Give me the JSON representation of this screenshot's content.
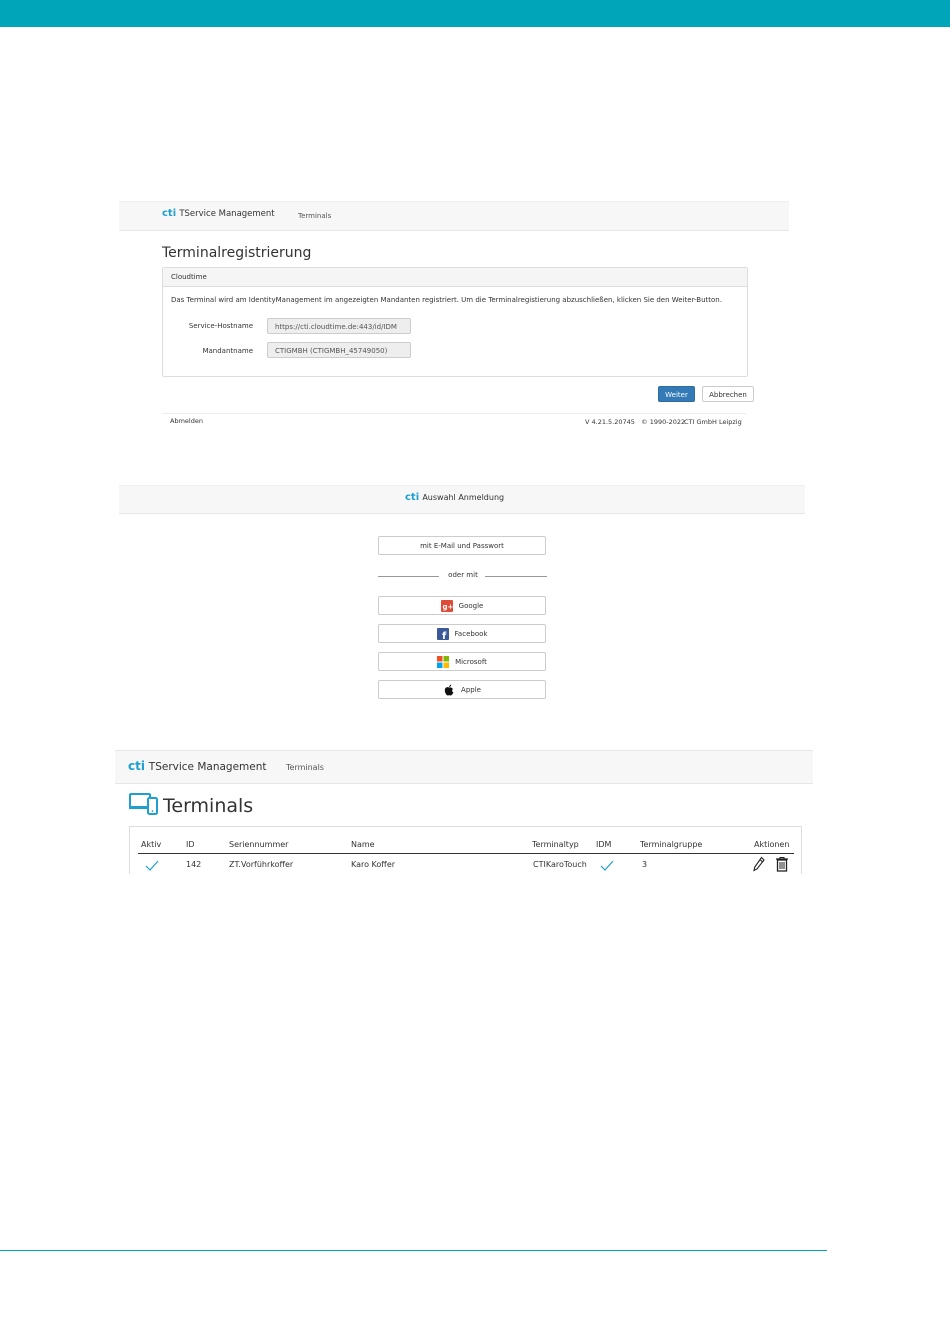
{
  "colors": {
    "accent": "#00a5b9",
    "brand": "#1e9fd0",
    "primary_button": "#337ab7"
  },
  "registration": {
    "brand_logo": "cti",
    "brand_name": "TService Management",
    "nav_link": "Terminals",
    "title": "Terminalregistrierung",
    "panel_heading": "Cloudtime",
    "description": "Das Terminal wird am IdentityManagement im angezeigten Mandanten registriert. Um die Terminalregistierung abzuschließen, klicken Sie den Weiter-Button.",
    "service_hostname_label": "Service-Hostname",
    "service_hostname_value": "https://cti.cloudtime.de:443/id/IDM",
    "mandant_label": "Mandantname",
    "mandant_value": "CTIGMBH (CTIGMBH_45749050)",
    "next_button": "Weiter",
    "cancel_button": "Abbrechen",
    "logout_link": "Abmelden",
    "version_text": "V 4.21.5.20745   © 1990-2022",
    "company_link": "CTI GmbH Leipzig"
  },
  "login_choice": {
    "brand_logo": "cti",
    "title": "Auswahl Anmeldung",
    "email_button": "mit E-Mail und Passwort",
    "divider": "oder mit",
    "providers": [
      {
        "label": "Google",
        "icon": "google-plus-icon"
      },
      {
        "label": "Facebook",
        "icon": "facebook-icon"
      },
      {
        "label": "Microsoft",
        "icon": "microsoft-icon"
      },
      {
        "label": "Apple",
        "icon": "apple-icon"
      }
    ]
  },
  "terminals": {
    "brand_logo": "cti",
    "brand_name": "TService Management",
    "nav_link": "Terminals",
    "title": "Terminals",
    "columns": [
      "Aktiv",
      "ID",
      "Seriennummer",
      "Name",
      "Terminaltyp",
      "IDM",
      "Terminalgruppe",
      "Aktionen"
    ],
    "rows": [
      {
        "active": true,
        "id": "142",
        "serial": "ZT.Vorführkoffer",
        "name": "Karo Koffer",
        "type": "CTIKaroTouch",
        "idm": true,
        "group": "3"
      }
    ]
  }
}
